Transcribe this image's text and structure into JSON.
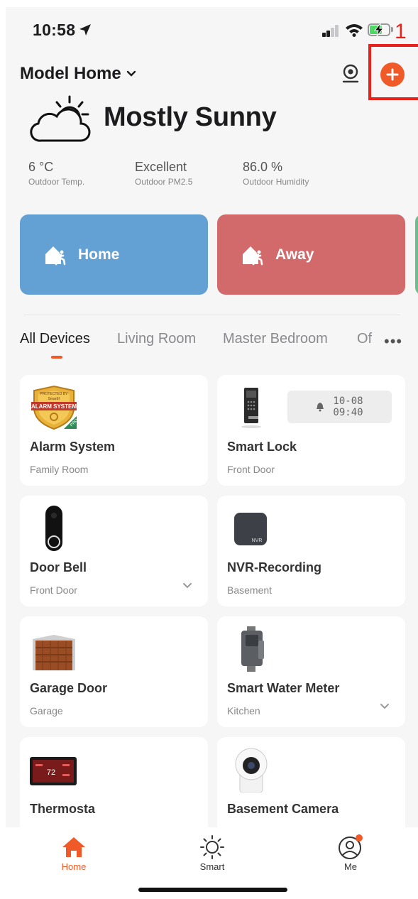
{
  "status_bar": {
    "time": "10:58"
  },
  "annotation": {
    "number": "1"
  },
  "header": {
    "home_name": "Model Home"
  },
  "weather": {
    "condition": "Mostly Sunny",
    "stats": [
      {
        "value": "6 °C",
        "label": "Outdoor Temp."
      },
      {
        "value": "Excellent",
        "label": "Outdoor PM2.5"
      },
      {
        "value": "86.0 %",
        "label": "Outdoor Humidity"
      }
    ]
  },
  "scenes": [
    {
      "label": "Home",
      "color": "#63a0d3"
    },
    {
      "label": "Away",
      "color": "#d26a6b"
    }
  ],
  "rooms": {
    "tabs": [
      "All Devices",
      "Living Room",
      "Master Bedroom",
      "Of"
    ],
    "active_index": 0
  },
  "devices": [
    {
      "name": "Alarm System",
      "room": "Family Room",
      "badge_top": "PROTECTED BY",
      "badge_brand": "SmartH",
      "badge_text": "ALARM SYSTEM",
      "badge_pro": "PRO"
    },
    {
      "name": "Smart Lock",
      "room": "Front Door",
      "status_date": "10-08",
      "status_time": "09:40"
    },
    {
      "name": "Door Bell",
      "room": "Front Door"
    },
    {
      "name": "NVR-Recording",
      "room": "Basement",
      "icon_text": "NVR"
    },
    {
      "name": "Garage Door",
      "room": "Garage"
    },
    {
      "name": "Smart Water Meter",
      "room": "Kitchen"
    },
    {
      "name": "Thermosta",
      "room": "",
      "icon_text": "72"
    },
    {
      "name": "Basement Camera",
      "room": ""
    }
  ],
  "tabbar": {
    "items": [
      "Home",
      "Smart",
      "Me"
    ]
  },
  "colors": {
    "accent": "#f05a28",
    "annotation": "#e8221b",
    "background": "#f6f6f6"
  }
}
